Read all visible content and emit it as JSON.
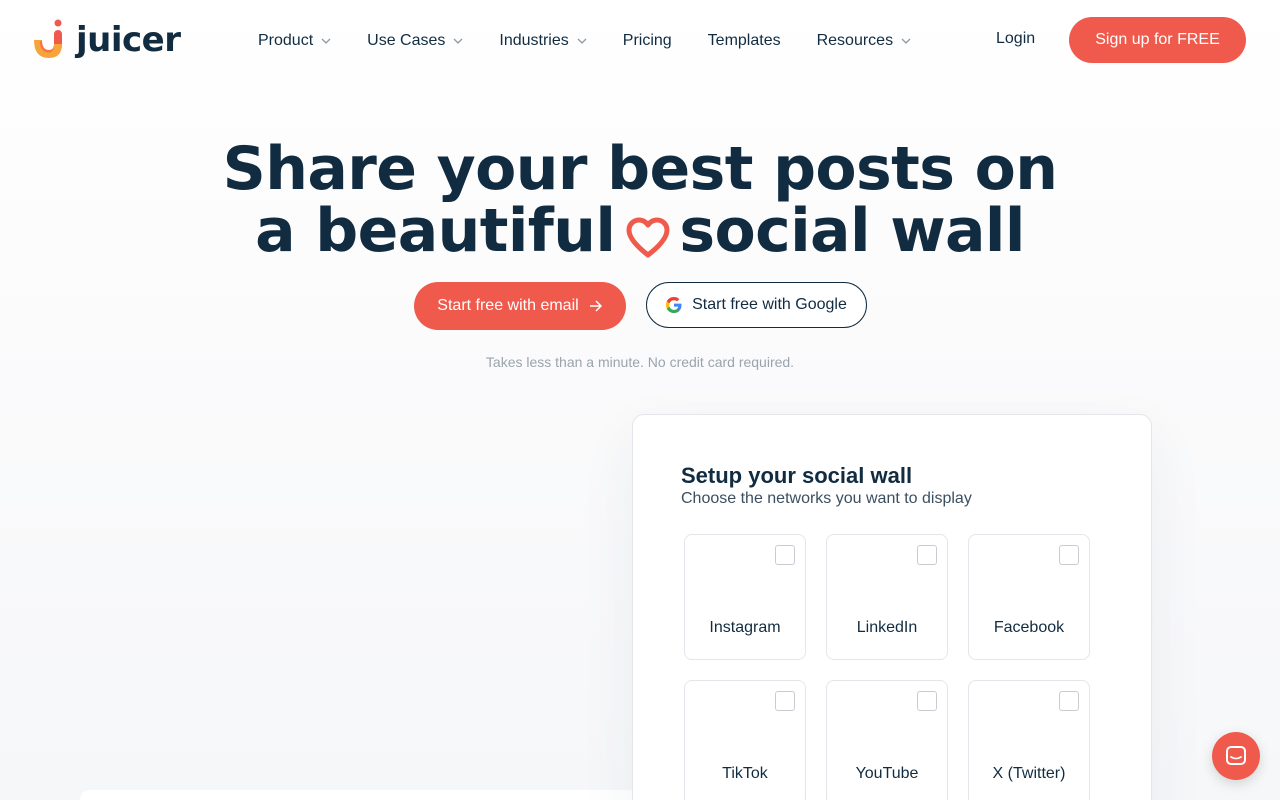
{
  "header": {
    "logo_text": "juicer",
    "nav": [
      {
        "label": "Product",
        "dropdown": true
      },
      {
        "label": "Use Cases",
        "dropdown": true
      },
      {
        "label": "Industries",
        "dropdown": true
      },
      {
        "label": "Pricing",
        "dropdown": false
      },
      {
        "label": "Templates",
        "dropdown": false
      },
      {
        "label": "Resources",
        "dropdown": true
      }
    ],
    "login": "Login",
    "signup": "Sign up for FREE"
  },
  "hero": {
    "title_line1": "Share your best posts on",
    "title_line2a": "a beautiful",
    "title_line2b": "social wall",
    "btn_email": "Start free with email",
    "btn_google": "Start free with Google",
    "note": "Takes less than a minute. No credit card required."
  },
  "setup": {
    "title": "Setup your social wall",
    "subtitle": "Choose the networks you want to display",
    "networks": [
      {
        "label": "Instagram",
        "checked": false
      },
      {
        "label": "LinkedIn",
        "checked": false
      },
      {
        "label": "Facebook",
        "checked": false
      },
      {
        "label": "TikTok",
        "checked": false
      },
      {
        "label": "YouTube",
        "checked": false
      },
      {
        "label": "X (Twitter)",
        "checked": false
      }
    ]
  },
  "colors": {
    "accent": "#ef5a4c",
    "navy": "#112c41"
  },
  "icons": {
    "heart": "heart-icon",
    "arrow": "arrow-right-icon",
    "google": "google-icon",
    "chat": "chat-icon"
  }
}
